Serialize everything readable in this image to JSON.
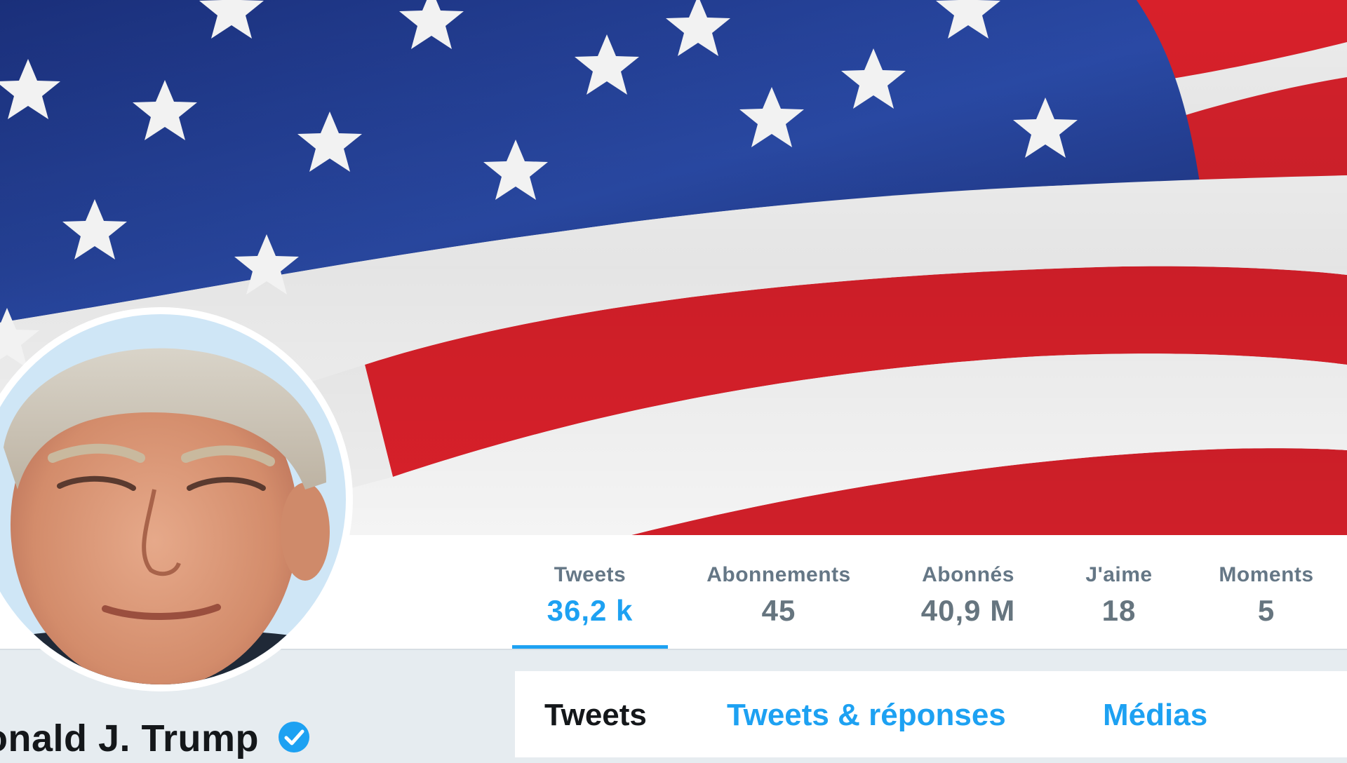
{
  "profile": {
    "name": "onald J. Trump",
    "verified": true,
    "avatar_icon": "profile-photo",
    "banner_icon": "american-flag-banner"
  },
  "stats": [
    {
      "label": "Tweets",
      "value": "36,2 k",
      "active": true
    },
    {
      "label": "Abonnements",
      "value": "45",
      "active": false
    },
    {
      "label": "Abonnés",
      "value": "40,9 M",
      "active": false
    },
    {
      "label": "J'aime",
      "value": "18",
      "active": false
    },
    {
      "label": "Moments",
      "value": "5",
      "active": false
    }
  ],
  "tabs": [
    {
      "label": "Tweets",
      "active": true
    },
    {
      "label": "Tweets & réponses",
      "active": false
    },
    {
      "label": "Médias",
      "active": false
    }
  ],
  "colors": {
    "accent": "#1da1f2",
    "flag_blue": "#1e3a8a",
    "flag_red": "#d8202a",
    "flag_white": "#f1f1f1",
    "text_dark": "#14171a",
    "text_muted": "#657786"
  }
}
